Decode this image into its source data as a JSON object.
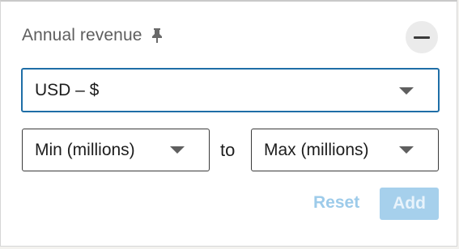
{
  "filter": {
    "title": "Annual revenue",
    "pin_icon": "pin-icon",
    "collapse_icon": "minus-icon"
  },
  "currency_select": {
    "value": "USD – $",
    "icon": "caret-down-icon"
  },
  "range": {
    "min_placeholder": "Min (millions)",
    "separator": "to",
    "max_placeholder": "Max (millions)"
  },
  "actions": {
    "reset_label": "Reset",
    "add_label": "Add"
  },
  "colors": {
    "focus_border": "#1f6ea7",
    "disabled_primary": "#a6d0ec",
    "disabled_text_link": "#9dcbea"
  }
}
